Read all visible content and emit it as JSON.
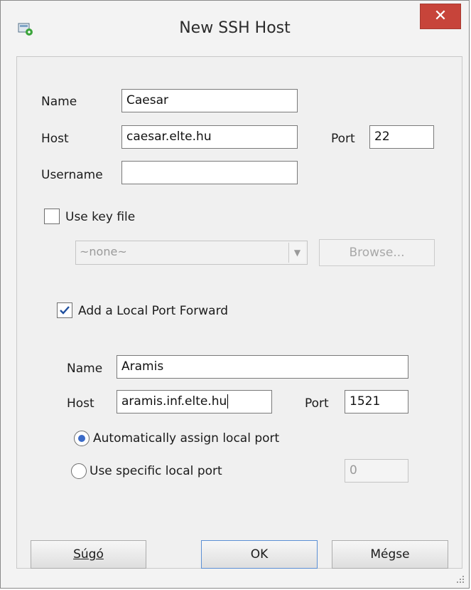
{
  "window": {
    "title": "New SSH Host",
    "close_glyph": "✕"
  },
  "host": {
    "name_label": "Name",
    "name_value": "Caesar",
    "host_label": "Host",
    "host_value": "caesar.elte.hu",
    "port_label": "Port",
    "port_value": "22",
    "username_label": "Username",
    "username_value": ""
  },
  "key_file": {
    "checkbox_label": "Use key file",
    "checked": false,
    "combo_value": "~none~",
    "browse_label": "Browse..."
  },
  "forward": {
    "checkbox_label": "Add a Local Port Forward",
    "checked": true,
    "name_label": "Name",
    "name_value": "Aramis",
    "host_label": "Host",
    "host_value": "aramis.inf.elte.hu",
    "port_label": "Port",
    "port_value": "1521",
    "auto_label": "Automatically assign local port",
    "specific_label": "Use specific local port",
    "specific_value": "0"
  },
  "buttons": {
    "help": "Súgó",
    "ok": "OK",
    "cancel": "Mégse"
  },
  "icons": {
    "app": "ssh-host-icon",
    "checkmark": "checkmark-icon",
    "dropdown": "chevron-down-icon",
    "grip": "resize-grip-icon"
  },
  "colors": {
    "close_button": "#c7443a",
    "accent": "#3b6bc8"
  }
}
